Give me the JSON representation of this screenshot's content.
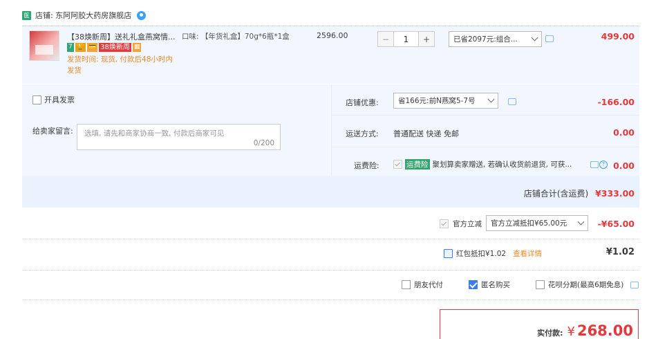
{
  "store": {
    "badge": "医",
    "label": "店铺: 东阿阿胶大药房旗舰店"
  },
  "item": {
    "title": "【38焕新周】送礼礼盒燕窝情...",
    "tags": [
      {
        "text": "7",
        "color": "#2fa678"
      },
      {
        "text": "🏆",
        "color": "#e8a317"
      },
      {
        "text": "💳",
        "color": "#f0a43a"
      },
      {
        "text": "38焕新周",
        "color": "#e4393c"
      },
      {
        "text": "▦",
        "color": "#f0a43a"
      }
    ],
    "ship_time": "发货时间: 现货, 付款后48小时内发货",
    "spec": "口味: 【年货礼盒】70g*6瓶*1盒",
    "price": "2596.00",
    "qty_minus": "−",
    "qty": "1",
    "qty_plus": "+",
    "discount_select": "已省2097元:组合...",
    "amount": "499.00"
  },
  "invoice": {
    "label": "开具发票"
  },
  "message": {
    "label": "给卖家留言:",
    "placeholder": "选填, 请先和商家协商一致, 付款后商家可见",
    "counter": "0/200"
  },
  "shop_discount": {
    "label": "店铺优惠:",
    "select": "省166元:前N燕窝5-7号",
    "amount": "-166.00"
  },
  "delivery": {
    "label": "运送方式:",
    "value": "普通配送 快递 免邮",
    "amount": "0.00"
  },
  "insurance": {
    "label": "运费险:",
    "tag": "运费险",
    "text": "聚划算卖家赠送, 若确认收货前退货, 可获...",
    "help": "?",
    "amount": "0.00"
  },
  "shop_total": {
    "label": "店铺合计(含运费)",
    "amount": "¥333.00"
  },
  "official": {
    "label": "官方立减",
    "select": "官方立减抵扣¥65.00元",
    "amount": "-¥65.00"
  },
  "redpacket": {
    "label": "红包抵扣¥1.02",
    "link": "查看详情",
    "amount": "¥1.02"
  },
  "options": {
    "friend_pay": "朋友代付",
    "anonymous": "匿名购买",
    "huabei": "花呗分期(最高6期免息)"
  },
  "pay": {
    "label": "实付款:",
    "currency": "¥",
    "amount": "268.00"
  }
}
